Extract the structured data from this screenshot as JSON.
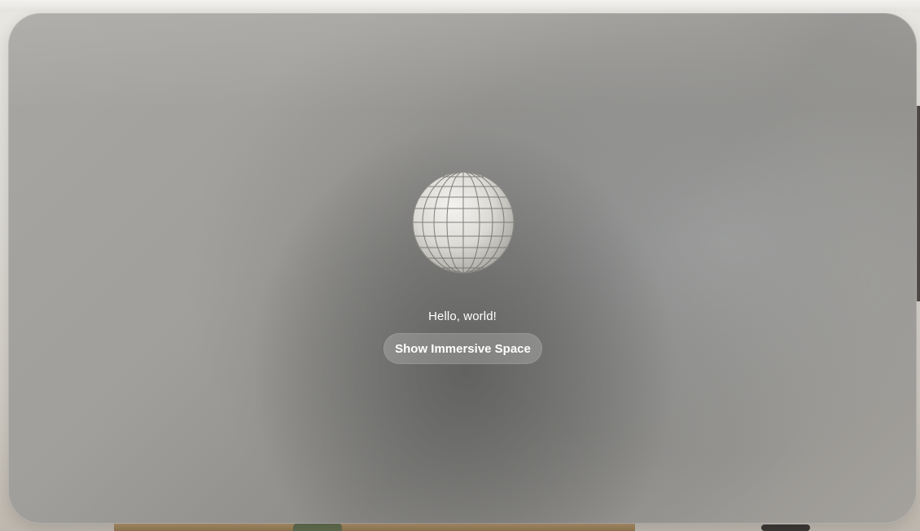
{
  "window": {
    "greeting": "Hello, world!",
    "button_label": "Show Immersive Space"
  },
  "icons": {
    "globe": "globe-model-icon"
  }
}
